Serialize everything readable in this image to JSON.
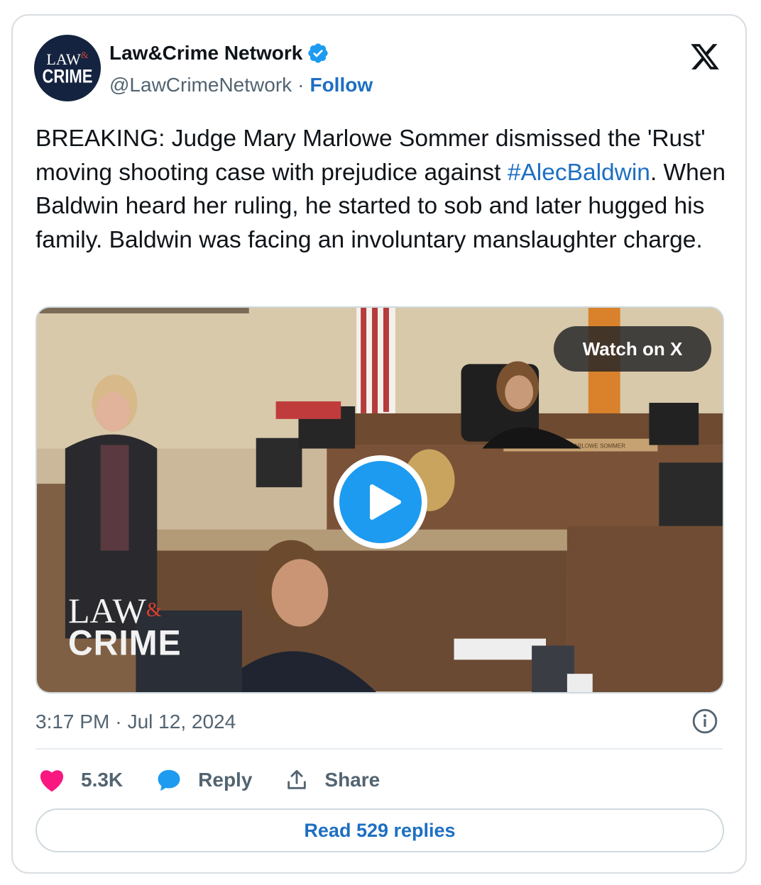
{
  "author": {
    "avatar_line1": "LAW",
    "avatar_amp": "&",
    "avatar_line2": "CRIME",
    "name": "Law&Crime Network",
    "handle": "@LawCrimeNetwork",
    "separator": "·",
    "follow_label": "Follow",
    "verified_icon": "verified-badge-icon"
  },
  "tweet": {
    "text_before": "BREAKING: Judge Mary Marlowe Sommer dismissed the 'Rust' moving shooting case with prejudice against ",
    "hashtag": "#AlecBaldwin",
    "text_after": ". When Baldwin heard her ruling, he started to sob and later hugged his family. Baldwin was facing an involuntary manslaughter charge."
  },
  "media": {
    "watch_label": "Watch on X",
    "play_icon": "play-icon",
    "watermark_line1": "LAW",
    "watermark_amp": "&",
    "watermark_line2": "CRIME",
    "nameplate": "HON. MARY MARLOWE SOMMER"
  },
  "meta": {
    "time": "3:17 PM",
    "separator": "·",
    "date": "Jul 12, 2024",
    "info_icon": "info-icon"
  },
  "actions": {
    "likes": "5.3K",
    "reply_label": "Reply",
    "share_label": "Share",
    "read_replies_label": "Read 529 replies"
  },
  "colors": {
    "link": "#1d6fc2",
    "heart": "#f91880",
    "reply_icon": "#1d9bf0",
    "muted": "#536471"
  }
}
